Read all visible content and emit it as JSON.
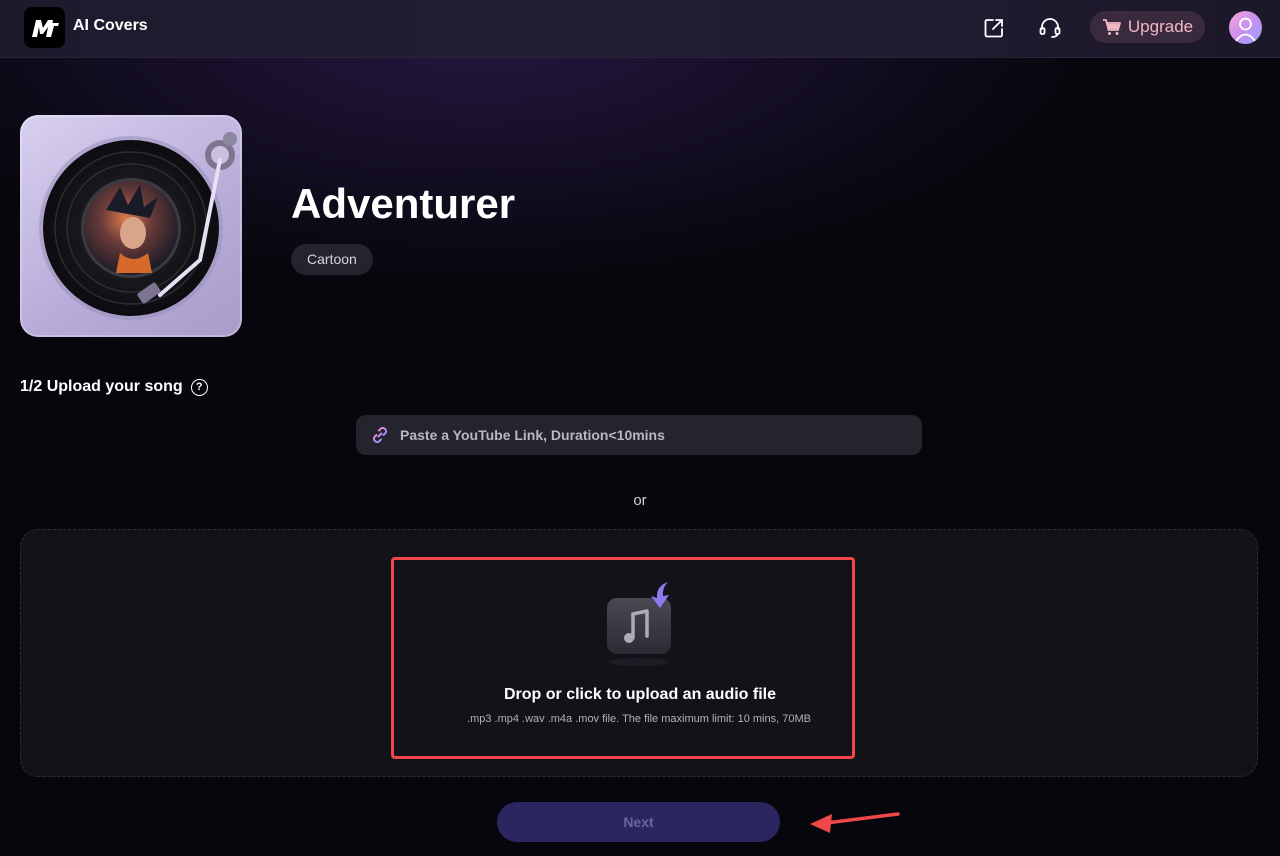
{
  "header": {
    "app_title": "AI Covers",
    "logo_icon": "mt-logo-icon",
    "icons": [
      "external-link-icon",
      "headset-support-icon"
    ],
    "upgrade_label": "Upgrade",
    "upgrade_icon": "cart-icon",
    "avatar_icon": "user-avatar-icon"
  },
  "voice": {
    "title": "Adventurer",
    "tag": "Cartoon",
    "cover_icon": "turntable-record-icon"
  },
  "upload": {
    "step_label": "1/2 Upload your song",
    "help_icon": "question-icon",
    "youtube_placeholder": "Paste a YouTube Link, Duration<10mins",
    "link_icon": "link-icon",
    "or_text": "or",
    "drop_title": "Drop or click to upload an audio file",
    "drop_hint": ".mp3 .mp4 .wav .m4a .mov file. The file maximum limit: 10 mins, 70MB",
    "drop_icon": "music-upload-icon"
  },
  "next_label": "Next",
  "colors": {
    "accent": "#8a7cf0",
    "highlight_box": "#f04848",
    "upgrade_text": "#f2b7c5",
    "next_bg": "#2b2560"
  }
}
